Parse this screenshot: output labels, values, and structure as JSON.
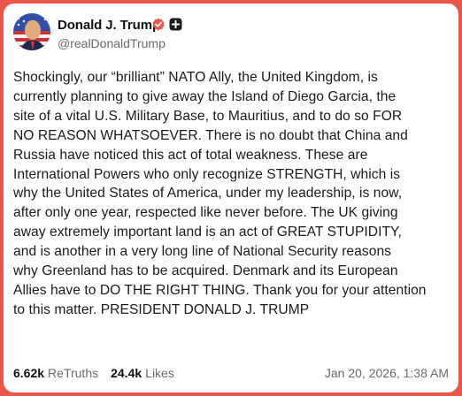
{
  "author": {
    "display_name": "Donald J. Trump",
    "handle": "@realDonaldTrump",
    "avatar_icon": "profile-photo",
    "verified_icon": "verified-badge-icon",
    "badge_color": "#e8574a"
  },
  "post": {
    "lines": [
      "Shockingly, our “brilliant” NATO Ally, the United Kingdom, is",
      "currently planning to give away the Island of Diego Garcia, the",
      "site of a vital U.S. Military Base, to Mauritius, and to do so FOR",
      "NO REASON WHATSOEVER. There is no doubt that China and",
      "Russia have noticed this act of total weakness. These are",
      "International Powers who only recognize STRENGTH, which is",
      "why the United States of America, under my leadership, is now,",
      "after only one year, respected like never before. The UK giving",
      "away extremely important land is an act of GREAT STUPIDITY,",
      "and is another in a very long line of National Security reasons",
      "why Greenland has to be acquired. Denmark and its European",
      "Allies have to DO THE RIGHT THING. Thank you for your attention",
      "to this matter. PRESIDENT DONALD J. TRUMP"
    ]
  },
  "stats": {
    "retruths_count": "6.62k",
    "retruths_label": "ReTruths",
    "likes_count": "24.4k",
    "likes_label": "Likes"
  },
  "timestamp": "Jan 20, 2026, 1:38 AM"
}
